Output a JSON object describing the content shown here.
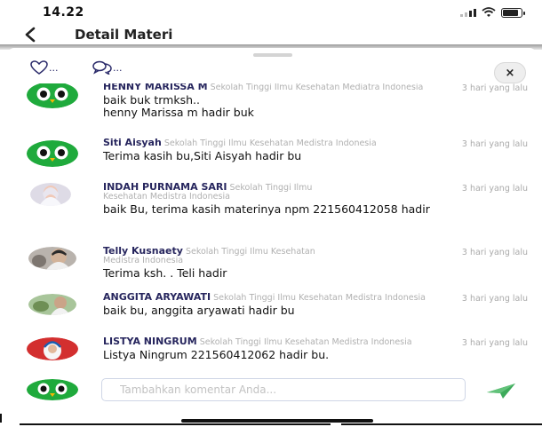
{
  "status_bar": {
    "time": "14.22",
    "signal_icon": "signal-icon",
    "wifi_icon": "wifi-icon",
    "battery_icon": "battery-icon"
  },
  "nav": {
    "back_icon": "chevron-left-icon",
    "title": "Detail Materi"
  },
  "sheet": {
    "like_count": "...",
    "comment_count": "...",
    "close_label": "×"
  },
  "comments": [
    {
      "name": "HENNY MARISSA M",
      "institution": "Sekolah Tinggi Ilmu Kesehatan Mediatra Indonesia",
      "time": "3 hari yang lalu",
      "text": "baik buk trmksh..\nhenny Marissa m hadir buk",
      "avatar": "owl-avatar"
    },
    {
      "name": "Siti Aisyah",
      "institution": "Sekolah Tinggi Ilmu Kesehatan Medistra Indonesia",
      "time": "3 hari yang lalu",
      "text": "Terima kasih bu,Siti Aisyah hadir bu",
      "avatar": "owl-avatar"
    },
    {
      "name": "INDAH PURNAMA SARI",
      "institution": "Sekolah Tinggi Ilmu Kesehatan Medistra Indonesia",
      "time": "3 hari yang lalu",
      "text": "baik Bu, terima kasih materinya npm 221560412058 hadir",
      "avatar": "photo-avatar"
    },
    {
      "name": "Telly Kusnaety",
      "institution": "Sekolah Tinggi Ilmu Kesehatan Medistra Indonesia",
      "time": "3 hari yang lalu",
      "text": "Terima ksh. . Teli hadir",
      "avatar": "photo-avatar"
    },
    {
      "name": "ANGGITA ARYAWATI",
      "institution": "Sekolah Tinggi Ilmu Kesehatan Medistra Indonesia",
      "time": "3 hari yang lalu",
      "text": "baik bu, anggita aryawati hadir bu",
      "avatar": "photo-avatar"
    },
    {
      "name": "LISTYA NINGRUM",
      "institution": "Sekolah Tinggi Ilmu Kesehatan Medistra Indonesia",
      "time": "3 hari yang lalu",
      "text": "Listya Ningrum 221560412062 hadir bu.",
      "avatar": "photo-avatar"
    }
  ],
  "composer": {
    "placeholder": "Tambahkan komentar Anda...",
    "send_icon": "send-icon"
  },
  "colors": {
    "name_color": "#27265e",
    "owl_green": "#1faa3c",
    "send_green": "#3daa5a"
  }
}
